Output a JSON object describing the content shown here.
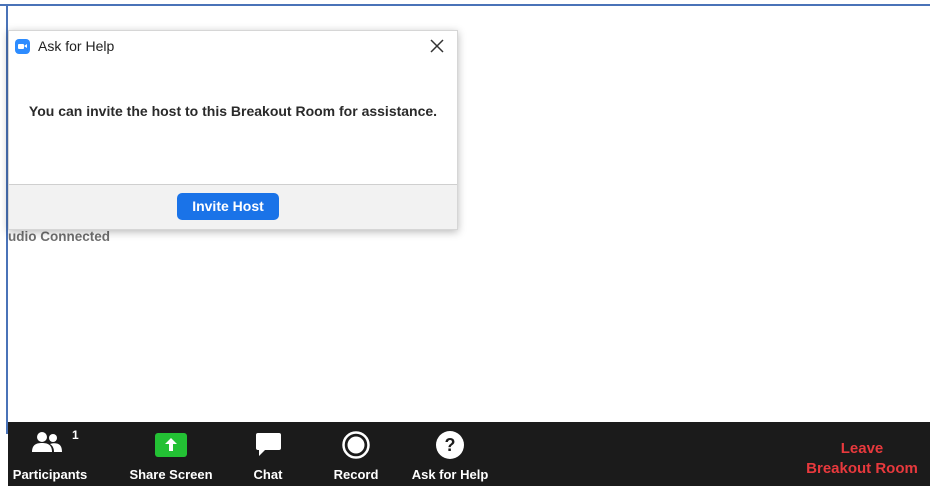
{
  "background": {
    "audio_status": "udio Connected"
  },
  "dialog": {
    "title": "Ask for Help",
    "message": "You can invite the host to this Breakout Room for assistance.",
    "invite_label": "Invite Host"
  },
  "toolbar": {
    "participants_label": "Participants",
    "participants_count": "1",
    "share_label": "Share Screen",
    "chat_label": "Chat",
    "record_label": "Record",
    "help_label": "Ask for Help",
    "leave_label_line1": "Leave",
    "leave_label_line2": "Breakout Room"
  },
  "colors": {
    "accent": "#1a73e8",
    "share_green": "#23c134",
    "leave_red": "#e8393d",
    "toolbar_bg": "#1b1b1b"
  },
  "icons": {
    "app": "zoom-camera-icon",
    "close": "close-icon",
    "participants": "people-icon",
    "share": "share-arrow-icon",
    "chat": "speech-bubble-icon",
    "record": "record-circle-icon",
    "help": "question-circle-icon"
  }
}
